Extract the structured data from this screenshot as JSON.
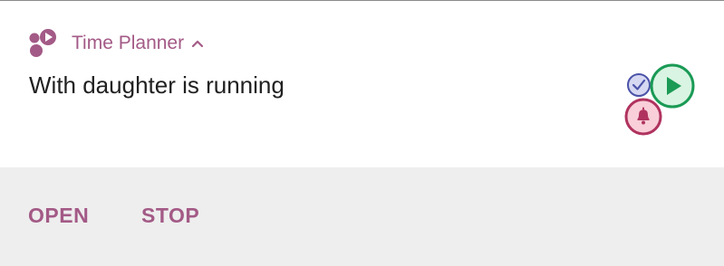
{
  "notification": {
    "app_name": "Time Planner",
    "title": "With daughter is running",
    "actions": {
      "open_label": "OPEN",
      "stop_label": "STOP"
    }
  },
  "icons": {
    "app": "time-planner-app-icon",
    "expand": "chevron-up-icon",
    "status": [
      "check-icon",
      "play-icon",
      "bell-icon"
    ]
  },
  "colors": {
    "accent": "#a35a86",
    "check_badge": "#4a52a8",
    "play_badge": "#1a9a55",
    "bell_badge": "#b0335f",
    "actions_background": "#eeeeee"
  }
}
